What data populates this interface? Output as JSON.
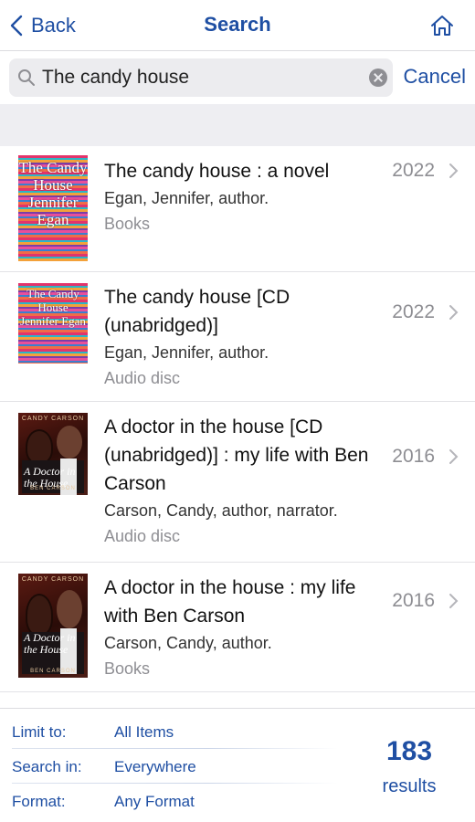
{
  "nav": {
    "back_label": "Back",
    "title": "Search"
  },
  "search": {
    "value": "The candy house",
    "cancel_label": "Cancel"
  },
  "results": [
    {
      "title": "The candy house : a novel",
      "author": "Egan, Jennifer, author.",
      "format": "Books",
      "year": "2022",
      "cover_text": "The Candy House Jennifer Egan"
    },
    {
      "title": "The candy house [CD (unabridged)]",
      "author": "Egan, Jennifer, author.",
      "format": "Audio disc",
      "year": "2022",
      "cover_text": "The Candy House Jennifer Egan"
    },
    {
      "title": "A doctor in the house [CD (unabridged)] : my life with Ben Carson",
      "author": "Carson, Candy, author, narrator.",
      "format": "Audio disc",
      "year": "2016",
      "cover_top": "CANDY CARSON",
      "cover_script": "A Doctor in the House",
      "cover_bottom": "BEN CARSON"
    },
    {
      "title": "A doctor in the house : my life with Ben Carson",
      "author": "Carson, Candy, author.",
      "format": "Books",
      "year": "2016",
      "cover_top": "CANDY CARSON",
      "cover_script": "A Doctor in the House",
      "cover_bottom": "BEN CARSON"
    }
  ],
  "footer": {
    "limit_label": "Limit to:",
    "limit_value": "All Items",
    "search_in_label": "Search in:",
    "search_in_value": "Everywhere",
    "format_label": "Format:",
    "format_value": "Any Format",
    "count": "183",
    "count_label": "results"
  },
  "colors": {
    "accent": "#1f4fa3",
    "secondary_text": "#8e8e93",
    "separator_band": "#eeeef2"
  }
}
